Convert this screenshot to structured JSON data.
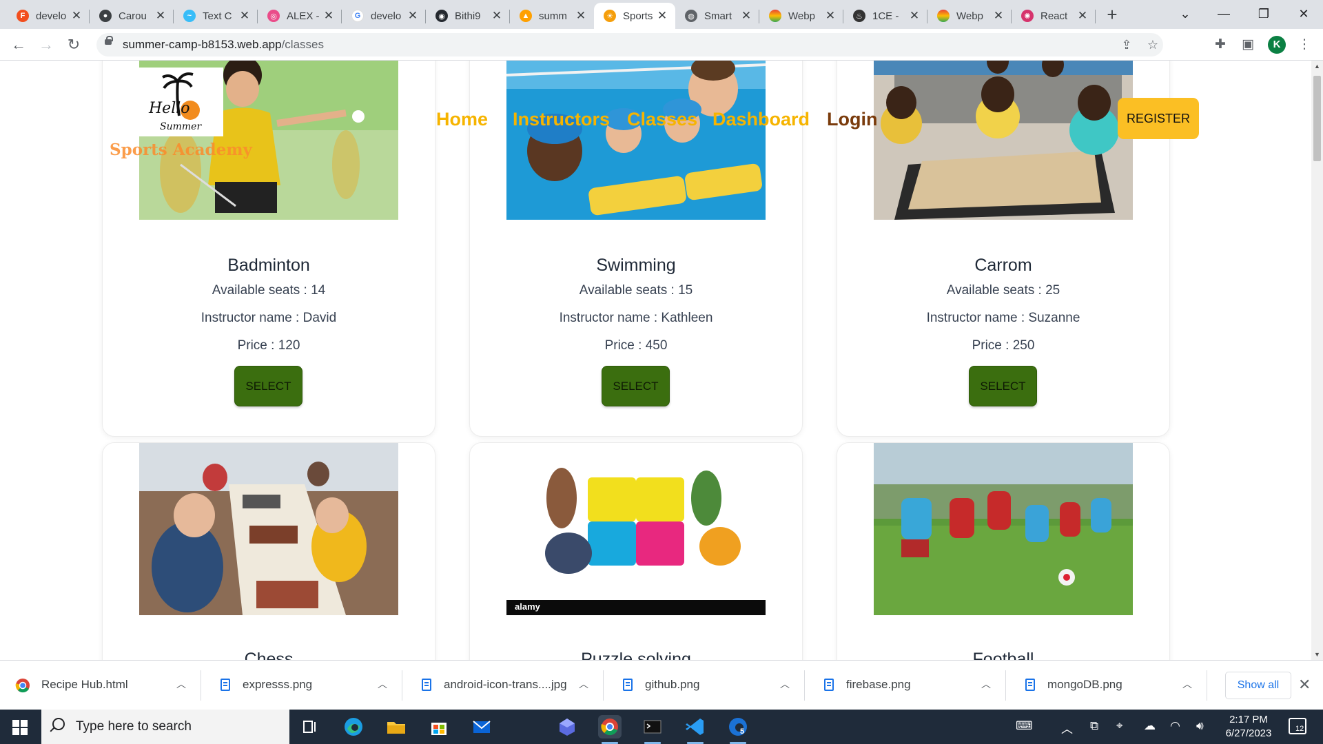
{
  "browser": {
    "tabs": [
      {
        "title": "develo",
        "favicon": "figma-icon",
        "color": "#f24e1e"
      },
      {
        "title": "Carou",
        "favicon": "generic-site-icon",
        "color": "#3c4043"
      },
      {
        "title": "Text C",
        "favicon": "tailwind-icon",
        "color": "#38bdf8"
      },
      {
        "title": "ALEX -",
        "favicon": "dribbble-icon",
        "color": "#ea4c89"
      },
      {
        "title": "develo",
        "favicon": "google-icon",
        "color": "#4285f4"
      },
      {
        "title": "Bithi9",
        "favicon": "github-icon",
        "color": "#24292f"
      },
      {
        "title": "summ",
        "favicon": "firebase-icon",
        "color": "#ffa000"
      },
      {
        "title": "Sports",
        "favicon": "sports-logo-icon",
        "color": "#f59e0b"
      },
      {
        "title": "Smart",
        "favicon": "globe-icon",
        "color": "#5f6368"
      },
      {
        "title": "Webp",
        "favicon": "rainbow-icon",
        "color": "#e94235"
      },
      {
        "title": "1CE -",
        "favicon": "fire-icon",
        "color": "#333333"
      },
      {
        "title": "Webp",
        "favicon": "rainbow-icon",
        "color": "#e94235"
      },
      {
        "title": "React",
        "favicon": "react-icon",
        "color": "#d6336c"
      }
    ],
    "active_tab": 7,
    "new_tab": "+",
    "url_host": "summer-camp-b8153.web.app",
    "url_path": "/classes",
    "profile_initial": "K"
  },
  "site": {
    "brand": "Sports Academy",
    "nav": {
      "home": "Home",
      "instructors": "Instructors",
      "classes": "Classes",
      "dashboard": "Dashboard",
      "login": "Login"
    },
    "register": "REGISTER",
    "logo_text": "Hello Summer"
  },
  "classes": [
    {
      "name": "Badminton",
      "seats_label": "Available seats : 14",
      "instructor_label": "Instructor name : David",
      "price_label": "Price : 120",
      "select": "SELECT"
    },
    {
      "name": "Swimming",
      "seats_label": "Available seats : 15",
      "instructor_label": "Instructor name : Kathleen",
      "price_label": "Price : 450",
      "select": "SELECT"
    },
    {
      "name": "Carrom",
      "seats_label": "Available seats : 25",
      "instructor_label": "Instructor name : Suzanne",
      "price_label": "Price : 250",
      "select": "SELECT"
    },
    {
      "name": "Chess"
    },
    {
      "name": "Puzzle solving",
      "watermark": "alamy"
    },
    {
      "name": "Football"
    }
  ],
  "downloads": {
    "items": [
      "Recipe Hub.html",
      "expresss.png",
      "android-icon-trans....jpg",
      "github.png",
      "firebase.png",
      "mongoDB.png"
    ],
    "show_all": "Show all"
  },
  "taskbar": {
    "search_placeholder": "Type here to search",
    "time": "2:17 PM",
    "date": "6/27/2023",
    "notifications": "12",
    "edge_badge": "5"
  },
  "colors": {
    "nav_link": "#f6b400",
    "login": "#7a3b0c",
    "register_bg": "#fbbf24",
    "select_bg": "#3b6e0f",
    "brand": "#fb8c2c"
  }
}
